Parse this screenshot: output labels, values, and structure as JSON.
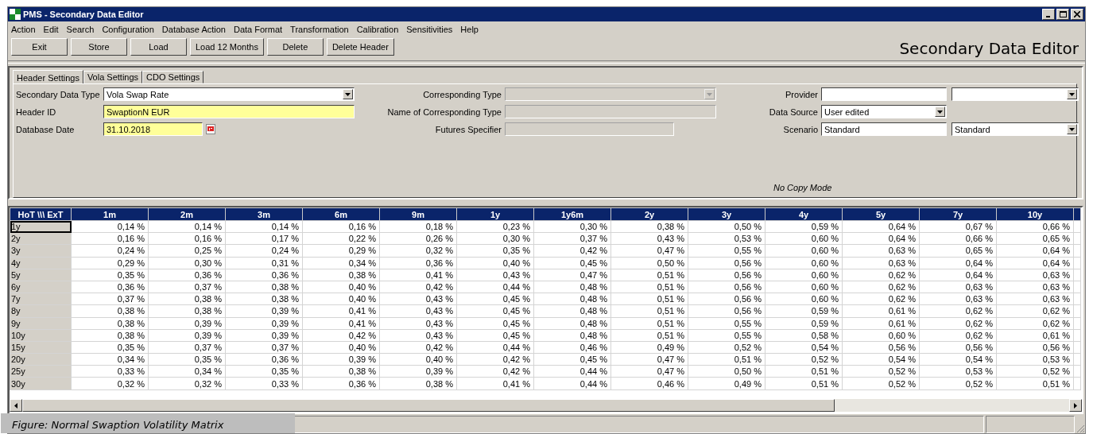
{
  "window": {
    "title": "PMS - Secondary Data Editor"
  },
  "menu": [
    "Action",
    "Edit",
    "Search",
    "Configuration",
    "Database Action",
    "Data Format",
    "Transformation",
    "Calibration",
    "Sensitivities",
    "Help"
  ],
  "toolbar": {
    "buttons": [
      "Exit",
      "Store",
      "Load",
      "Load 12 Months",
      "Delete",
      "Delete Header"
    ],
    "app_title": "Secondary Data Editor"
  },
  "tabs": [
    {
      "label": "Header Settings",
      "selected": true
    },
    {
      "label": "Vola Settings",
      "selected": false
    },
    {
      "label": "CDO Settings",
      "selected": false
    }
  ],
  "form": {
    "columns": [
      {
        "rows": [
          {
            "label": "Secondary Data Type",
            "fields": [
              {
                "kind": "combo",
                "value": "Vola Swap Rate",
                "highlighted": false,
                "disabled": false
              }
            ]
          },
          {
            "label": "Header ID",
            "fields": [
              {
                "kind": "text",
                "value": "SwaptionN EUR",
                "highlighted": true,
                "disabled": false
              }
            ]
          },
          {
            "label": "Database Date",
            "fields": [
              {
                "kind": "date",
                "value": "31.10.2018",
                "highlighted": true,
                "disabled": false
              }
            ]
          }
        ]
      },
      {
        "rows": [
          {
            "label": "Corresponding Type",
            "fields": [
              {
                "kind": "combo",
                "highlighted": false,
                "disabled": true
              }
            ]
          },
          {
            "label": "Name of Corresponding Type",
            "fields": [
              {
                "kind": "text",
                "highlighted": false,
                "disabled": true
              }
            ]
          },
          {
            "label": "Futures Specifier",
            "fields": [
              {
                "kind": "short",
                "highlighted": false,
                "disabled": true
              }
            ]
          }
        ]
      },
      {
        "rows": [
          {
            "label": "Provider",
            "fields": [
              {
                "kind": "text",
                "highlighted": false,
                "disabled": false
              },
              {
                "kind": "combo",
                "highlighted": false,
                "disabled": false
              }
            ]
          },
          {
            "label": "Data Source",
            "fields": [
              {
                "kind": "combo",
                "value": "User edited",
                "highlighted": false,
                "disabled": false
              }
            ]
          },
          {
            "label": "Scenario",
            "fields": [
              {
                "kind": "text",
                "value": "Standard",
                "highlighted": false,
                "disabled": false
              },
              {
                "kind": "combo",
                "value": "Standard",
                "highlighted": false,
                "disabled": false
              }
            ]
          }
        ]
      }
    ],
    "mode": "No Copy Mode"
  },
  "table": {
    "corner": "HoT \\\\\\ ExT",
    "columns": [
      "1m",
      "2m",
      "3m",
      "6m",
      "9m",
      "1y",
      "1y6m",
      "2y",
      "3y",
      "4y",
      "5y",
      "7y",
      "10y"
    ],
    "rows": [
      {
        "label": "1y",
        "selected": true,
        "values": [
          "0,14 %",
          "0,14 %",
          "0,14 %",
          "0,16 %",
          "0,18 %",
          "0,23 %",
          "0,30 %",
          "0,38 %",
          "0,50 %",
          "0,59 %",
          "0,64 %",
          "0,67 %",
          "0,66 %"
        ]
      },
      {
        "label": "2y",
        "selected": false,
        "values": [
          "0,16 %",
          "0,16 %",
          "0,17 %",
          "0,22 %",
          "0,26 %",
          "0,30 %",
          "0,37 %",
          "0,43 %",
          "0,53 %",
          "0,60 %",
          "0,64 %",
          "0,66 %",
          "0,65 %"
        ]
      },
      {
        "label": "3y",
        "selected": false,
        "values": [
          "0,24 %",
          "0,25 %",
          "0,24 %",
          "0,29 %",
          "0,32 %",
          "0,35 %",
          "0,42 %",
          "0,47 %",
          "0,55 %",
          "0,60 %",
          "0,63 %",
          "0,65 %",
          "0,64 %"
        ]
      },
      {
        "label": "4y",
        "selected": false,
        "values": [
          "0,29 %",
          "0,30 %",
          "0,31 %",
          "0,34 %",
          "0,36 %",
          "0,40 %",
          "0,45 %",
          "0,50 %",
          "0,56 %",
          "0,60 %",
          "0,63 %",
          "0,64 %",
          "0,64 %"
        ]
      },
      {
        "label": "5y",
        "selected": false,
        "values": [
          "0,35 %",
          "0,36 %",
          "0,36 %",
          "0,38 %",
          "0,41 %",
          "0,43 %",
          "0,47 %",
          "0,51 %",
          "0,56 %",
          "0,60 %",
          "0,62 %",
          "0,64 %",
          "0,63 %"
        ]
      },
      {
        "label": "6y",
        "selected": false,
        "values": [
          "0,36 %",
          "0,37 %",
          "0,38 %",
          "0,40 %",
          "0,42 %",
          "0,44 %",
          "0,48 %",
          "0,51 %",
          "0,56 %",
          "0,60 %",
          "0,62 %",
          "0,63 %",
          "0,63 %"
        ]
      },
      {
        "label": "7y",
        "selected": false,
        "values": [
          "0,37 %",
          "0,38 %",
          "0,38 %",
          "0,40 %",
          "0,43 %",
          "0,45 %",
          "0,48 %",
          "0,51 %",
          "0,56 %",
          "0,60 %",
          "0,62 %",
          "0,63 %",
          "0,63 %"
        ]
      },
      {
        "label": "8y",
        "selected": false,
        "values": [
          "0,38 %",
          "0,38 %",
          "0,39 %",
          "0,41 %",
          "0,43 %",
          "0,45 %",
          "0,48 %",
          "0,51 %",
          "0,56 %",
          "0,59 %",
          "0,61 %",
          "0,62 %",
          "0,62 %"
        ]
      },
      {
        "label": "9y",
        "selected": false,
        "values": [
          "0,38 %",
          "0,39 %",
          "0,39 %",
          "0,41 %",
          "0,43 %",
          "0,45 %",
          "0,48 %",
          "0,51 %",
          "0,55 %",
          "0,59 %",
          "0,61 %",
          "0,62 %",
          "0,62 %"
        ]
      },
      {
        "label": "10y",
        "selected": false,
        "values": [
          "0,38 %",
          "0,39 %",
          "0,39 %",
          "0,42 %",
          "0,43 %",
          "0,45 %",
          "0,48 %",
          "0,51 %",
          "0,55 %",
          "0,58 %",
          "0,60 %",
          "0,62 %",
          "0,61 %"
        ]
      },
      {
        "label": "15y",
        "selected": false,
        "values": [
          "0,35 %",
          "0,37 %",
          "0,37 %",
          "0,40 %",
          "0,42 %",
          "0,44 %",
          "0,46 %",
          "0,49 %",
          "0,52 %",
          "0,54 %",
          "0,56 %",
          "0,56 %",
          "0,56 %"
        ]
      },
      {
        "label": "20y",
        "selected": false,
        "values": [
          "0,34 %",
          "0,35 %",
          "0,36 %",
          "0,39 %",
          "0,40 %",
          "0,42 %",
          "0,45 %",
          "0,47 %",
          "0,51 %",
          "0,52 %",
          "0,54 %",
          "0,54 %",
          "0,53 %"
        ]
      },
      {
        "label": "25y",
        "selected": false,
        "values": [
          "0,33 %",
          "0,34 %",
          "0,35 %",
          "0,38 %",
          "0,39 %",
          "0,42 %",
          "0,44 %",
          "0,47 %",
          "0,50 %",
          "0,51 %",
          "0,52 %",
          "0,53 %",
          "0,52 %"
        ]
      },
      {
        "label": "30y",
        "selected": false,
        "values": [
          "0,32 %",
          "0,32 %",
          "0,33 %",
          "0,36 %",
          "0,38 %",
          "0,41 %",
          "0,44 %",
          "0,46 %",
          "0,49 %",
          "0,51 %",
          "0,52 %",
          "0,52 %",
          "0,51 %"
        ]
      }
    ]
  },
  "caption": "Figure: Normal Swaption Volatility Matrix"
}
